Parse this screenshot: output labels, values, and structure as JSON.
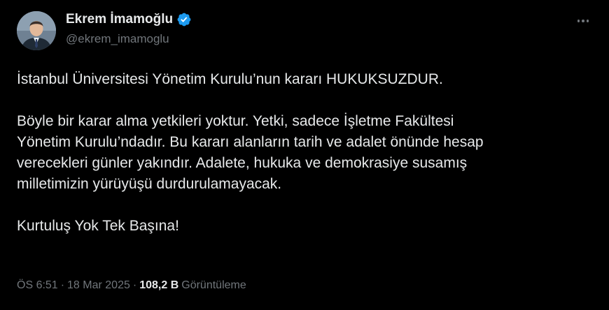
{
  "author": {
    "display_name": "Ekrem İmamoğlu",
    "handle": "@ekrem_imamoglu",
    "verified_icon": "verified-badge-icon"
  },
  "post": {
    "paragraphs": [
      [
        "İstanbul Üniversitesi Yönetim Kurulu’nun kararı HUKUKSUZDUR."
      ],
      [
        "Böyle bir karar alma yetkileri yoktur. Yetki, sadece İşletme Fakültesi",
        "Yönetim Kurulu’ndadır. Bu kararı alanların tarih ve adalet önünde hesap",
        "verecekleri günler yakındır. Adalete, hukuka ve demokrasiye susamış",
        "milletimizin yürüyüşü durdurulamayacak."
      ],
      [
        "Kurtuluş Yok Tek Başına!"
      ]
    ]
  },
  "meta": {
    "time": "ÖS 6:51",
    "separator": "·",
    "date": "18 Mar 2025",
    "views_count": "108,2 B",
    "views_label": "Görüntüleme"
  },
  "colors": {
    "background": "#000000",
    "text": "#e7e9ea",
    "secondary": "#71767b",
    "verified": "#1d9bf0"
  },
  "icons": {
    "more": "more-options-icon",
    "verified": "verified-badge-icon"
  }
}
